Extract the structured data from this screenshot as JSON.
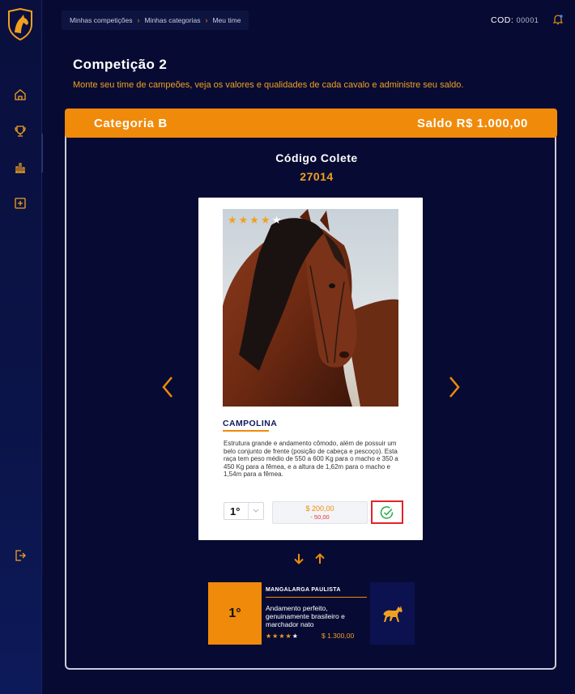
{
  "breadcrumb": {
    "items": [
      "Minhas competições",
      "Minhas categorias",
      "Meu time"
    ]
  },
  "header": {
    "cod_label": "COD:",
    "cod_value": "00001"
  },
  "page": {
    "title": "Competição 2",
    "subtitle": "Monte seu time de campeões, veja os valores e qualidades de cada cavalo e administre seu saldo."
  },
  "category": {
    "name": "Categoria B",
    "balance": "Saldo R$ 1.000,00"
  },
  "colete": {
    "label": "Código Colete",
    "code": "27014"
  },
  "card": {
    "stars_filled": 4,
    "stars_total": 5,
    "name": "CAMPOLINA",
    "description": "Estrutura grande e andamento cômodo, além de possuir um belo conjunto de frente (posição de cabeça e pescoço). Esta raça tem peso médio de 550 a 600 Kg para o macho e 350 a 450 Kg para a fêmea, e a altura de 1,62m para o macho e 1,54m para a fêmea.",
    "rank": "1°",
    "price": "$ 200,00",
    "price_diff": "- 50,00"
  },
  "ranked": {
    "position": "1°",
    "name": "MANGALARGA PAULISTA",
    "description": "Andamento perfeito, genuinamente brasileiro e marchador nato",
    "stars_filled": 4,
    "stars_total": 5,
    "price": "$ 1.300,00"
  },
  "colors": {
    "accent": "#f08a0a",
    "background": "#070b33",
    "error": "#e2232a"
  }
}
